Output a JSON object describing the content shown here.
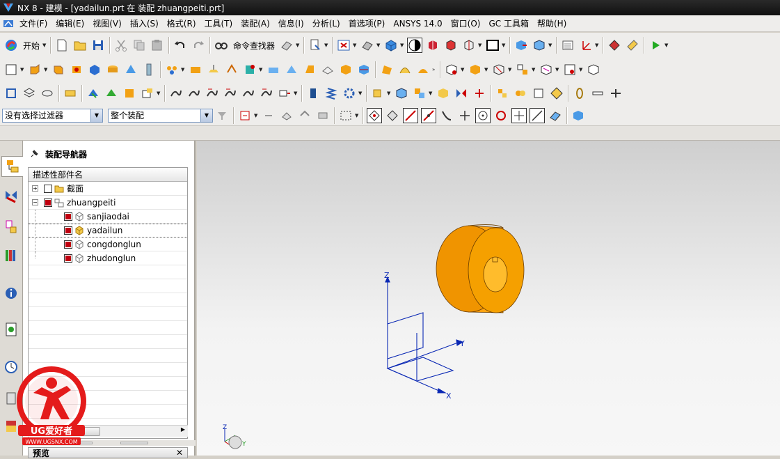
{
  "window": {
    "title": "NX 8 - 建模 - [yadailun.prt 在 装配 zhuangpeiti.prt]"
  },
  "menu": [
    "文件(F)",
    "编辑(E)",
    "视图(V)",
    "插入(S)",
    "格式(R)",
    "工具(T)",
    "装配(A)",
    "信息(I)",
    "分析(L)",
    "首选项(P)",
    "ANSYS 14.0",
    "窗口(O)",
    "GC 工具箱",
    "帮助(H)"
  ],
  "toolbar": {
    "start_label": "开始",
    "command_finder_label": "命令查找器"
  },
  "selection_bar": {
    "filter_value": "没有选择过滤器",
    "scope_value": "整个装配"
  },
  "navigator": {
    "title": "装配导航器",
    "column_header": "描述性部件名",
    "nodes": [
      {
        "label": "截面",
        "checked": false
      },
      {
        "label": "zhuangpeiti",
        "checked": true
      },
      {
        "label": "sanjiaodai",
        "checked": true
      },
      {
        "label": "yadailun",
        "checked": true
      },
      {
        "label": "congdonglun",
        "checked": true
      },
      {
        "label": "zhudonglun",
        "checked": true
      }
    ]
  },
  "preview": {
    "title": "预览"
  },
  "viewport": {
    "axis_x": "X",
    "axis_y": "Y",
    "axis_z": "Z",
    "part_color": "#f5a000"
  },
  "watermark": {
    "brand": "UG爱好者",
    "url": "WWW.UGSNX.COM"
  }
}
